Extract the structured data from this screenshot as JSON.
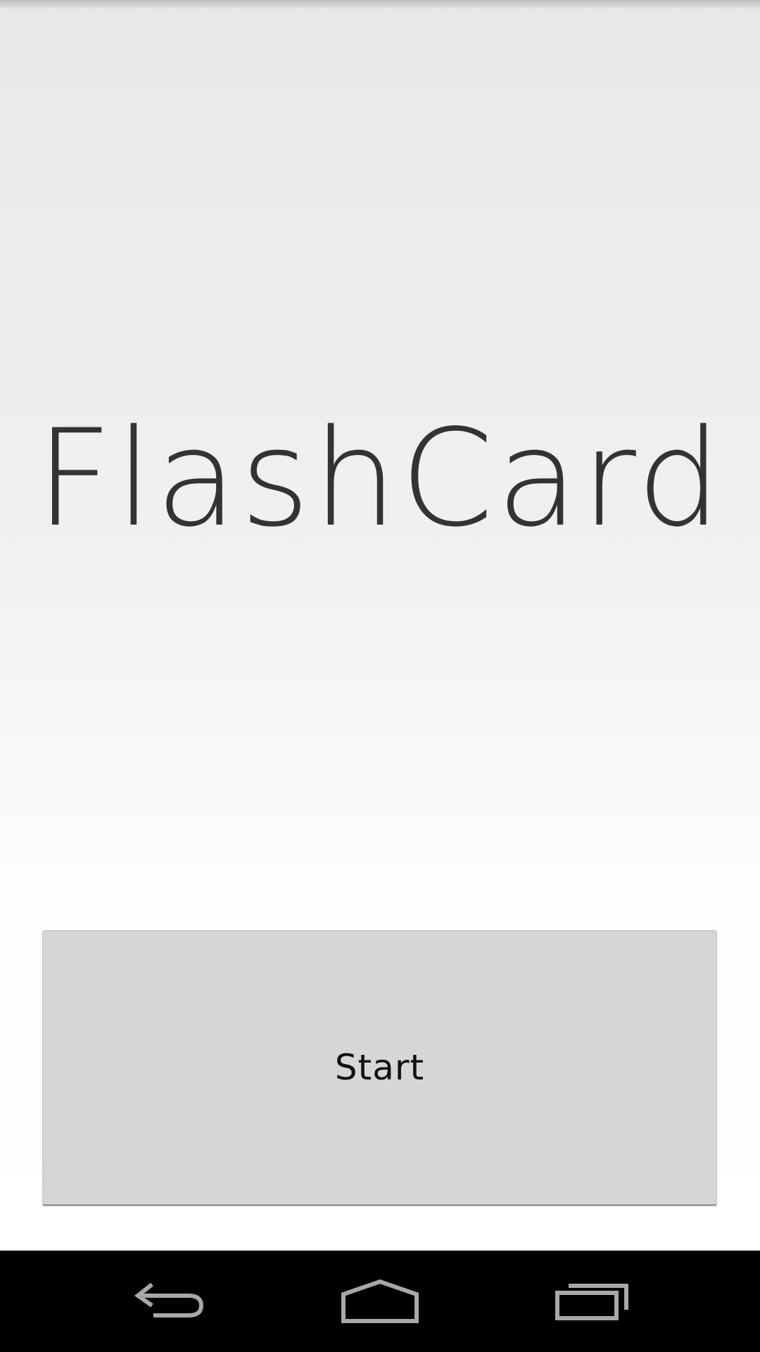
{
  "app": {
    "title": "FlashCard",
    "start_label": "Start"
  },
  "navbar": {
    "back_icon": "back-icon",
    "home_icon": "home-icon",
    "recents_icon": "recents-icon",
    "icon_color": "#a8a8a8"
  },
  "colors": {
    "title_text": "#333333",
    "button_bg": "#d6d6d6",
    "navbar_bg": "#000000"
  }
}
